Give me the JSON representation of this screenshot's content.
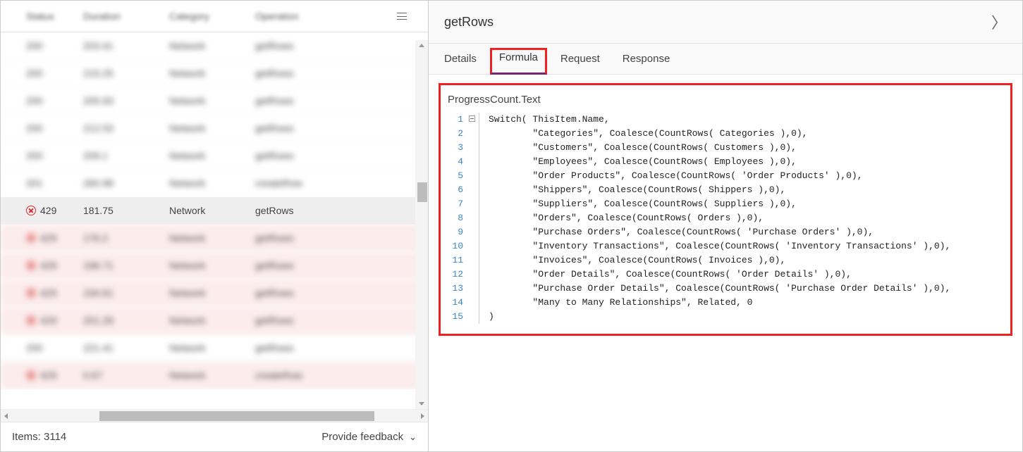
{
  "table": {
    "headers": [
      "Status",
      "Duration",
      "Category",
      "Operation"
    ],
    "rows": [
      {
        "status": "200",
        "duration": "203.41",
        "category": "Network",
        "operation": "getRows",
        "err": false,
        "sel": false,
        "blur": true
      },
      {
        "status": "200",
        "duration": "215.25",
        "category": "Network",
        "operation": "getRows",
        "err": false,
        "sel": false,
        "blur": true
      },
      {
        "status": "200",
        "duration": "205.93",
        "category": "Network",
        "operation": "getRows",
        "err": false,
        "sel": false,
        "blur": true
      },
      {
        "status": "200",
        "duration": "212.53",
        "category": "Network",
        "operation": "getRows",
        "err": false,
        "sel": false,
        "blur": true
      },
      {
        "status": "200",
        "duration": "209.1",
        "category": "Network",
        "operation": "getRows",
        "err": false,
        "sel": false,
        "blur": true
      },
      {
        "status": "201",
        "duration": "260.98",
        "category": "Network",
        "operation": "createRow",
        "err": false,
        "sel": false,
        "blur": true
      },
      {
        "status": "429",
        "duration": "181.75",
        "category": "Network",
        "operation": "getRows",
        "err": true,
        "sel": true,
        "blur": false
      },
      {
        "status": "429",
        "duration": "176.2",
        "category": "Network",
        "operation": "getRows",
        "err": true,
        "sel": false,
        "blur": true
      },
      {
        "status": "429",
        "duration": "196.71",
        "category": "Network",
        "operation": "getRows",
        "err": true,
        "sel": false,
        "blur": true
      },
      {
        "status": "429",
        "duration": "194.61",
        "category": "Network",
        "operation": "getRows",
        "err": true,
        "sel": false,
        "blur": true
      },
      {
        "status": "429",
        "duration": "201.28",
        "category": "Network",
        "operation": "getRows",
        "err": true,
        "sel": false,
        "blur": true
      },
      {
        "status": "200",
        "duration": "221.41",
        "category": "Network",
        "operation": "getRows",
        "err": false,
        "sel": false,
        "blur": true
      },
      {
        "status": "429",
        "duration": "0.67",
        "category": "Network",
        "operation": "createRow",
        "err": true,
        "sel": false,
        "blur": true
      }
    ]
  },
  "footer": {
    "itemsLabel": "Items: 3114",
    "feedbackLabel": "Provide feedback"
  },
  "detail": {
    "title": "getRows",
    "tabs": [
      "Details",
      "Formula",
      "Request",
      "Response"
    ],
    "activeTab": 1,
    "propertyName": "ProgressCount.Text",
    "codeLines": [
      "Switch( ThisItem.Name,",
      "        \"Categories\", Coalesce(CountRows( Categories ),0),",
      "        \"Customers\", Coalesce(CountRows( Customers ),0),",
      "        \"Employees\", Coalesce(CountRows( Employees ),0),",
      "        \"Order Products\", Coalesce(CountRows( 'Order Products' ),0),",
      "        \"Shippers\", Coalesce(CountRows( Shippers ),0),",
      "        \"Suppliers\", Coalesce(CountRows( Suppliers ),0),",
      "        \"Orders\", Coalesce(CountRows( Orders ),0),",
      "        \"Purchase Orders\", Coalesce(CountRows( 'Purchase Orders' ),0),",
      "        \"Inventory Transactions\", Coalesce(CountRows( 'Inventory Transactions' ),0),",
      "        \"Invoices\", Coalesce(CountRows( Invoices ),0),",
      "        \"Order Details\", Coalesce(CountRows( 'Order Details' ),0),",
      "        \"Purchase Order Details\", Coalesce(CountRows( 'Purchase Order Details' ),0),",
      "        \"Many to Many Relationships\", Related, 0",
      ")"
    ]
  }
}
